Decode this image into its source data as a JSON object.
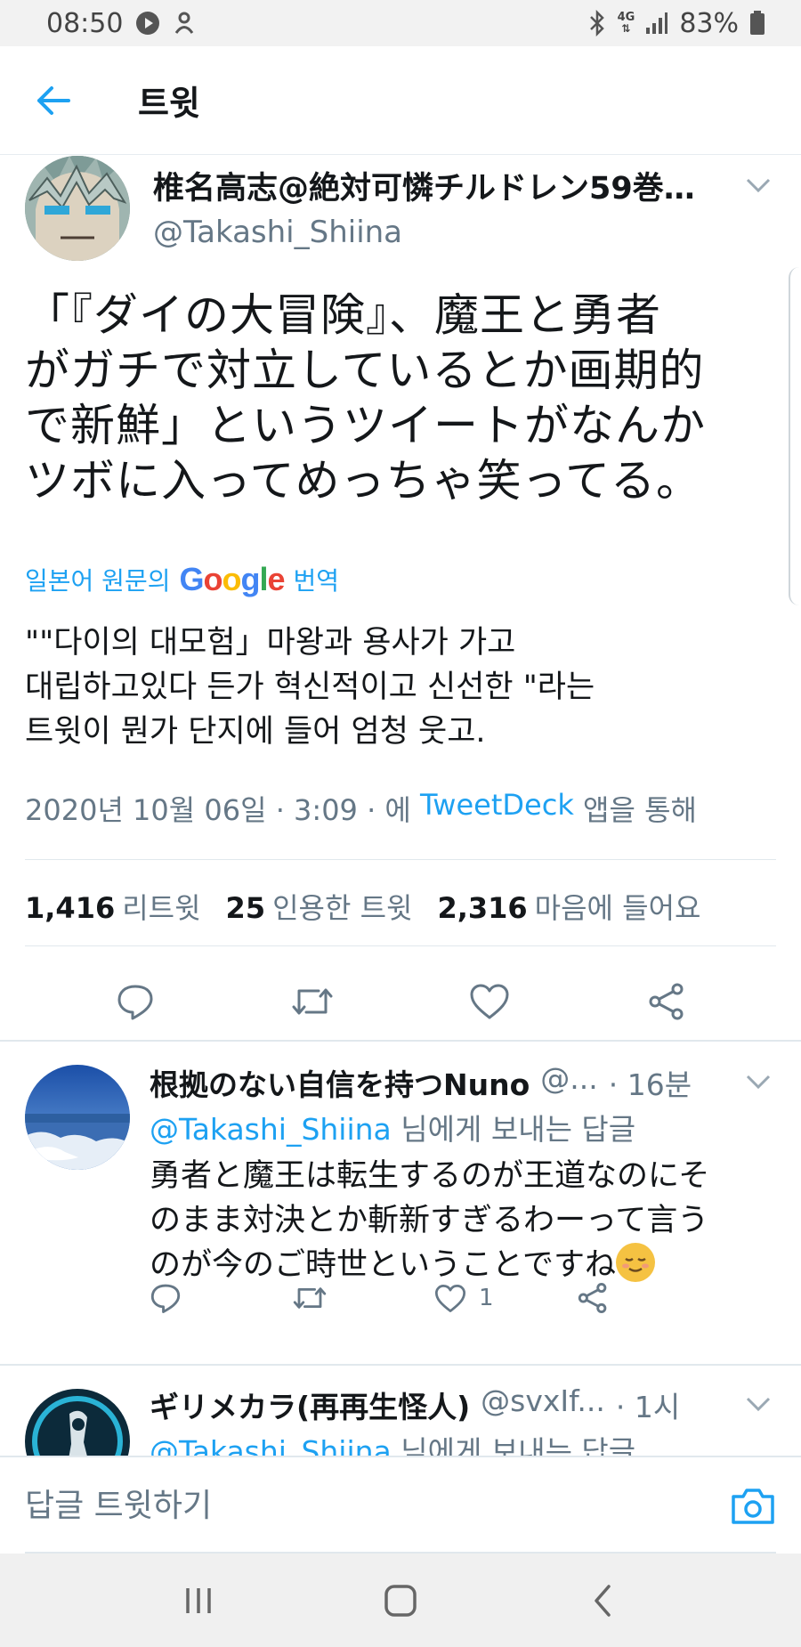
{
  "status_bar": {
    "time": "08:50",
    "network": "4G",
    "battery": "83%"
  },
  "header": {
    "title": "트윗"
  },
  "tweet": {
    "author_name": "椎名高志@絶対可憐チルドレン59巻…",
    "author_handle": "@Takashi_Shiina",
    "text": "「『ダイの大冒険』、魔王と勇者\nがガチで対立しているとか画期的\nで新鮮」というツイートがなんか\nツボに入ってめっちゃ笑ってる。",
    "translate_prefix": "일본어 원문의",
    "translate_brand": "Google",
    "translate_suffix": "번역",
    "translated_text": "\"\"다이의 대모험」마왕과 용사가 가고\n대립하고있다 든가 혁신적이고 신선한 \"라는\n트윗이 뭔가 단지에 들어 엄청 웃고.",
    "meta_date": "2020년 10월 06일 · 3:09 · 에 ",
    "meta_source": "TweetDeck",
    "meta_suffix": " 앱을 통해",
    "stats": {
      "retweets_count": "1,416",
      "retweets_label": "리트윗",
      "quotes_count": "25",
      "quotes_label": "인용한 트윗",
      "likes_count": "2,316",
      "likes_label": "마음에 들어요"
    }
  },
  "replies": [
    {
      "name": "根拠のない自信を持つNuno",
      "handle": "@...",
      "time": "· 16분",
      "reply_to_mention": "@Takashi_Shiina",
      "reply_to_suffix": " 님에게 보내는 답글",
      "text": "勇者と魔王は転生するのが王道なのにそ\nのまま対決とか斬新すぎるわーって言う\nのが今のご時世ということですね",
      "like_count": "1"
    },
    {
      "name": "ギリメカラ(再再生怪人)",
      "handle": "@svxIf...",
      "time": "· 1시",
      "reply_to_mention": "@Takashi_Shiina",
      "reply_to_suffix": " 님에게 보내는 답글"
    }
  ],
  "composer": {
    "placeholder": "답글 트윗하기"
  },
  "colors": {
    "accent": "#1da1f2",
    "secondary_text": "#657786",
    "primary_text": "#14171a"
  },
  "icons": [
    "back-arrow-icon",
    "chevron-down-icon",
    "reply-icon",
    "retweet-icon",
    "heart-icon",
    "share-icon",
    "camera-icon",
    "recents-icon",
    "home-icon",
    "back-icon"
  ]
}
